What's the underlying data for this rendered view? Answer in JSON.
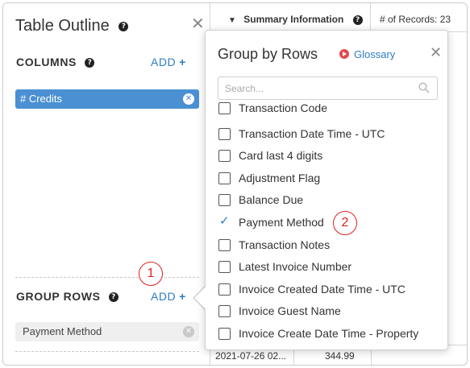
{
  "outline": {
    "title": "Table Outline",
    "columns_label": "COLUMNS",
    "add_label": "ADD",
    "column_chip": "# Credits",
    "group_rows_label": "GROUP ROWS",
    "group_chip": "Payment Method"
  },
  "summary": {
    "title": "Summary Information",
    "records": "# of Records: 23"
  },
  "table": {
    "row_date": "2021-07-26 02...",
    "row_value": "344.99"
  },
  "popover": {
    "title": "Group by Rows",
    "glossary": "Glossary",
    "search_placeholder": "Search...",
    "items": [
      {
        "label": "Transaction Code",
        "checked": false
      },
      {
        "label": "Transaction Date Time - UTC",
        "checked": false
      },
      {
        "label": "Card last 4 digits",
        "checked": false
      },
      {
        "label": "Adjustment Flag",
        "checked": false
      },
      {
        "label": "Balance Due",
        "checked": false
      },
      {
        "label": "Payment Method",
        "checked": true
      },
      {
        "label": "Transaction Notes",
        "checked": false
      },
      {
        "label": "Latest Invoice Number",
        "checked": false
      },
      {
        "label": "Invoice Created Date Time - UTC",
        "checked": false
      },
      {
        "label": "Invoice Guest Name",
        "checked": false
      },
      {
        "label": "Invoice Create Date Time - Property",
        "checked": false
      }
    ]
  },
  "annotations": {
    "one": "1",
    "two": "2"
  },
  "colors": {
    "accent": "#2d7dc4",
    "chip_blue": "#4a90d2",
    "annotation_red": "#e02020"
  }
}
